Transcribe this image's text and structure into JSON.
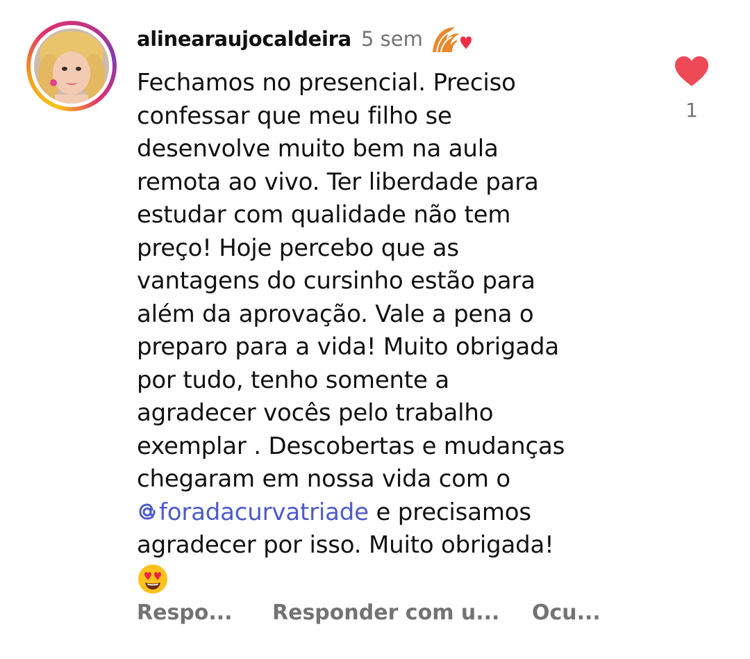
{
  "comment": {
    "username": "alinearaujocaldeira",
    "time_ago": "5 sem",
    "badge_icon": "eagle-heart-badge-icon",
    "lines": [
      "Fechamos no presencial. Preciso",
      "confessar que meu filho se",
      "desenvolve muito bem na aula",
      "remota ao vivo. Ter liberdade para",
      "estudar com qualidade não tem",
      "preço! Hoje percebo que as",
      "vantagens do cursinho estão para",
      "além da aprovação. Vale a pena o",
      "preparo para a vida! Muito obrigada",
      "por tudo, tenho somente a",
      "agradecer vocês pelo trabalho",
      "exemplar . Descobertas e mudanças",
      "chegaram em nossa vida com o"
    ],
    "mention": "foradacurvatriade",
    "after_mention": " e precisamos",
    "line_final": "agradecer por isso. Muito obrigada!",
    "emoji": "heart-eyes-emoji-icon",
    "like_count": "1"
  },
  "actions": {
    "reply": "Respo...",
    "reply_with": "Responder com u...",
    "hide": "Ocu..."
  },
  "colors": {
    "like_heart": "#ed4956",
    "mention": "#4d5acb",
    "secondary_text": "#737373"
  }
}
